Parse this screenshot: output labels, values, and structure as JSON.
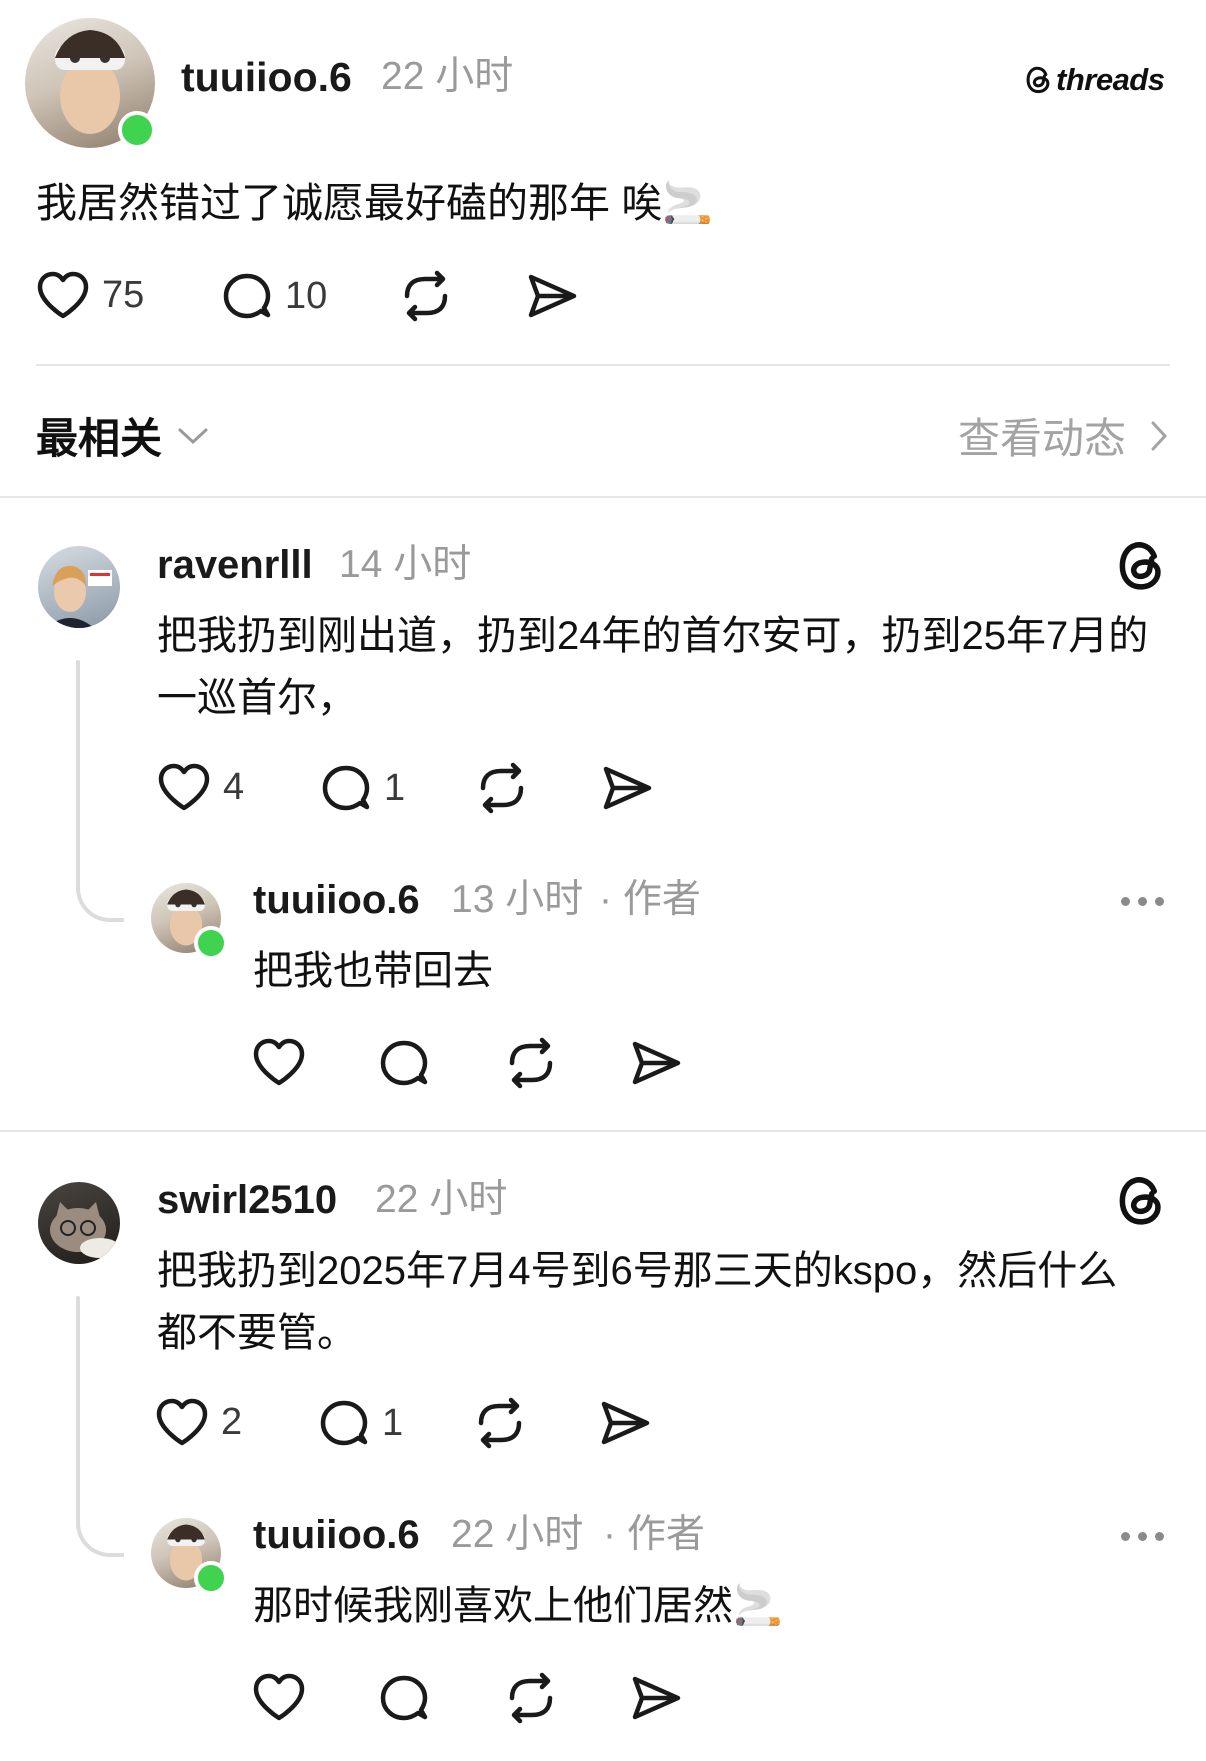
{
  "post": {
    "username": "tuuiioo.6",
    "time": "22 小时",
    "brand": "threads",
    "text": "我居然错过了诚愿最好磕的那年 唉🚬",
    "likes": "75",
    "replies": "10"
  },
  "sort": {
    "label": "最相关",
    "view_activity": "查看动态"
  },
  "comments": [
    {
      "username": "ravenrlll",
      "time": "14 小时",
      "text": "把我扔到刚出道，扔到24年的首尔安可，扔到25年7月的一巡首尔，",
      "likes": "4",
      "replies": "1",
      "reply": {
        "username": "tuuiioo.6",
        "time": "13 小时",
        "author_tag": "· 作者",
        "text": "把我也带回去"
      }
    },
    {
      "username": "swirl2510",
      "time": "22 小时",
      "text": "把我扔到2025年7月4号到6号那三天的kspo，然后什么都不要管。",
      "likes": "2",
      "replies": "1",
      "reply": {
        "username": "tuuiioo.6",
        "time": "22 小时",
        "author_tag": "· 作者",
        "text": "那时候我刚喜欢上他们居然🚬"
      }
    }
  ],
  "icons": {
    "like": "heart-icon",
    "reply": "comment-bubble-icon",
    "repost": "repost-icon",
    "share": "send-icon",
    "more": "more-dots-icon",
    "threads": "threads-logo-icon"
  },
  "colors": {
    "online": "#3fd34f",
    "muted_text": "#9a9a9a",
    "divider": "#e6e6e6"
  }
}
